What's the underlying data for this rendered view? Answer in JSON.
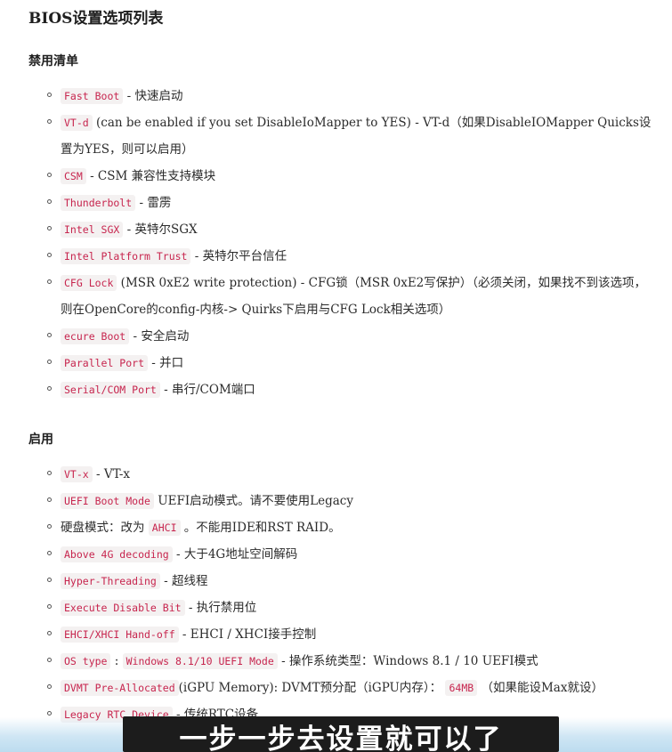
{
  "title": "BIOS设置选项列表",
  "disable": {
    "heading": "禁用清单",
    "items": [
      {
        "code": "Fast Boot",
        "text": " - 快速启动"
      },
      {
        "code": "VT-d",
        "text": " (can be enabled if you set DisableIoMapper to YES) - VT-d（如果DisableIOMapper Quicks设置为YES，则可以启用）"
      },
      {
        "code": "CSM",
        "text": " - CSM 兼容性支持模块"
      },
      {
        "code": "Thunderbolt",
        "text": " - 雷雳"
      },
      {
        "code": "Intel SGX",
        "text": " - 英特尔SGX"
      },
      {
        "code": "Intel Platform Trust",
        "text": " - 英特尔平台信任"
      },
      {
        "code": "CFG Lock",
        "text": " (MSR 0xE2 write protection) - CFG锁（MSR 0xE2写保护）（必须关闭，如果找不到该选项，则在OpenCore的config-内核-> Quirks下启用与CFG Lock相关选项）"
      },
      {
        "code": "ecure Boot",
        "text": " - 安全启动"
      },
      {
        "code": "Parallel Port",
        "text": " - 并口"
      },
      {
        "code": "Serial/COM Port",
        "text": " - 串行/COM端口"
      }
    ]
  },
  "enable": {
    "heading": "启用",
    "items": [
      {
        "pre": "",
        "code": "VT-x",
        "text": " - VT-x"
      },
      {
        "pre": "",
        "code": "UEFI Boot Mode",
        "text": " UEFI启动模式。请不要使用Legacy"
      },
      {
        "pre": "硬盘模式：改为 ",
        "code": "AHCI",
        "text": " 。不能用IDE和RST RAID。"
      },
      {
        "pre": "",
        "code": "Above 4G decoding",
        "text": " - 大于4G地址空间解码"
      },
      {
        "pre": "",
        "code": "Hyper-Threading",
        "text": " - 超线程"
      },
      {
        "pre": "",
        "code": "Execute Disable Bit",
        "text": " - 执行禁用位"
      },
      {
        "pre": "",
        "code": "EHCI/XHCI Hand-off",
        "text": " - EHCI / XHCI接手控制"
      },
      {
        "pre": "",
        "code": "OS type",
        "mid": " : ",
        "code2": "Windows 8.1/10 UEFI Mode",
        "text": " - 操作系统类型：Windows 8.1 / 10 UEFI模式"
      },
      {
        "pre": "",
        "code": "DVMT Pre-Allocated",
        "mid": "(iGPU Memory): DVMT预分配（iGPU内存）： ",
        "code2": "64MB",
        "text": " （如果能设Max就设）"
      },
      {
        "pre": "",
        "code": "Legacy RTC Device",
        "text": " - 传统RTC设备"
      }
    ]
  },
  "subtitle": "一步一步去设置就可以了"
}
